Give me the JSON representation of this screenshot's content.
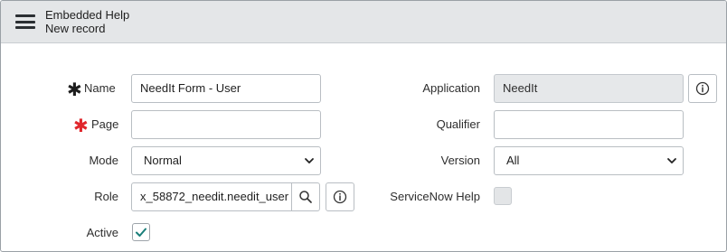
{
  "header": {
    "title": "Embedded Help",
    "subtitle": "New record"
  },
  "form": {
    "name": {
      "label": "Name",
      "value": "NeedIt Form - User",
      "mandatory_style": "filled"
    },
    "page": {
      "label": "Page",
      "value": "",
      "mandatory_style": "required-empty"
    },
    "mode": {
      "label": "Mode",
      "selected": "Normal"
    },
    "role": {
      "label": "Role",
      "value": "x_58872_needit.needit_user"
    },
    "active": {
      "label": "Active",
      "checked": true
    },
    "application": {
      "label": "Application",
      "value": "NeedIt"
    },
    "qualifier": {
      "label": "Qualifier",
      "value": ""
    },
    "version": {
      "label": "Version",
      "selected": "All"
    },
    "servicenow_help": {
      "label": "ServiceNow Help",
      "checked": false
    }
  },
  "colors": {
    "mandatory_required": "#e0262c",
    "mandatory_filled": "#1d1d1d",
    "checkbox_check": "#1a7f7a",
    "header_bg": "#e4e6e8"
  },
  "icons": [
    "menu-icon",
    "info-icon",
    "search-icon",
    "chevron-down-icon",
    "checkmark-icon"
  ]
}
